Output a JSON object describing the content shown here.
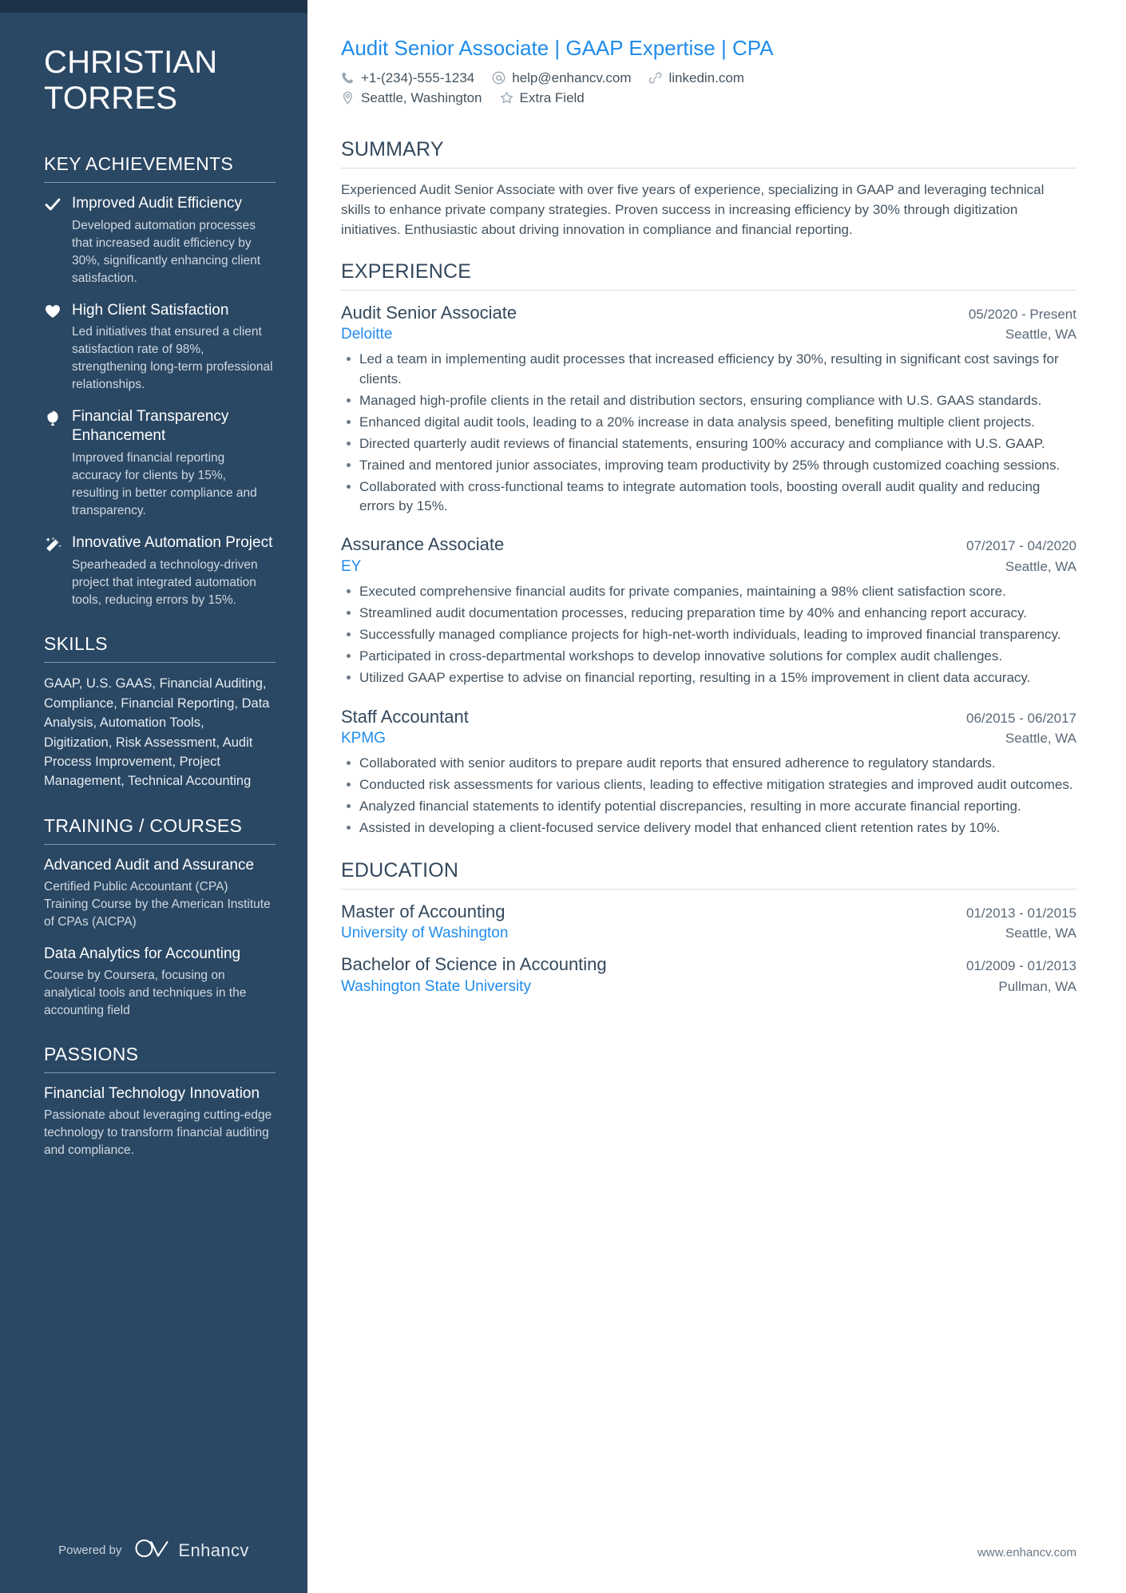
{
  "sidebar": {
    "name": "CHRISTIAN TORRES",
    "achievements": {
      "heading": "KEY ACHIEVEMENTS",
      "items": [
        {
          "icon": "check-icon",
          "title": "Improved Audit Efficiency",
          "desc": "Developed automation processes that increased audit efficiency by 30%, significantly enhancing client satisfaction."
        },
        {
          "icon": "heart-icon",
          "title": "High Client Satisfaction",
          "desc": "Led initiatives that ensured a client satisfaction rate of 98%, strengthening long-term professional relationships."
        },
        {
          "icon": "balloon-icon",
          "title": "Financial Transparency Enhancement",
          "desc": "Improved financial reporting accuracy for clients by 15%, resulting in better compliance and transparency."
        },
        {
          "icon": "magic-wand-icon",
          "title": "Innovative Automation Project",
          "desc": "Spearheaded a technology-driven project that integrated automation tools, reducing errors by 15%."
        }
      ]
    },
    "skills": {
      "heading": "SKILLS",
      "text": "GAAP, U.S. GAAS, Financial Auditing, Compliance, Financial Reporting, Data Analysis, Automation Tools, Digitization, Risk Assessment, Audit Process Improvement, Project Management, Technical Accounting"
    },
    "training": {
      "heading": "TRAINING / COURSES",
      "items": [
        {
          "title": "Advanced Audit and Assurance",
          "desc": "Certified Public Accountant (CPA) Training Course by the American Institute of CPAs (AICPA)"
        },
        {
          "title": "Data Analytics for Accounting",
          "desc": "Course by Coursera, focusing on analytical tools and techniques in the accounting field"
        }
      ]
    },
    "passions": {
      "heading": "PASSIONS",
      "items": [
        {
          "title": "Financial Technology Innovation",
          "desc": "Passionate about leveraging cutting-edge technology to transform financial auditing and compliance."
        }
      ]
    },
    "footer": {
      "powered_by": "Powered by",
      "brand": "Enhancv",
      "logo_icon": "enhancv-logo-icon"
    }
  },
  "main": {
    "headline": "Audit Senior Associate | GAAP Expertise | CPA",
    "contact": {
      "row1": [
        {
          "icon": "phone-icon",
          "value": "+1-(234)-555-1234"
        },
        {
          "icon": "email-icon",
          "value": "help@enhancv.com"
        },
        {
          "icon": "link-icon",
          "value": "linkedin.com"
        }
      ],
      "row2": [
        {
          "icon": "location-pin-icon",
          "value": "Seattle, Washington"
        },
        {
          "icon": "star-icon",
          "value": "Extra Field"
        }
      ]
    },
    "summary": {
      "heading": "SUMMARY",
      "text": "Experienced Audit Senior Associate with over five years of experience, specializing in GAAP and leveraging technical skills to enhance private company strategies. Proven success in increasing efficiency by 30% through digitization initiatives. Enthusiastic about driving innovation in compliance and financial reporting."
    },
    "experience": {
      "heading": "EXPERIENCE",
      "jobs": [
        {
          "title": "Audit Senior Associate",
          "dates": "05/2020 - Present",
          "company": "Deloitte",
          "location": "Seattle, WA",
          "bullets": [
            "Led a team in implementing audit processes that increased efficiency by 30%, resulting in significant cost savings for clients.",
            "Managed high-profile clients in the retail and distribution sectors, ensuring compliance with U.S. GAAS standards.",
            "Enhanced digital audit tools, leading to a 20% increase in data analysis speed, benefiting multiple client projects.",
            "Directed quarterly audit reviews of financial statements, ensuring 100% accuracy and compliance with U.S. GAAP.",
            "Trained and mentored junior associates, improving team productivity by 25% through customized coaching sessions.",
            "Collaborated with cross-functional teams to integrate automation tools, boosting overall audit quality and reducing errors by 15%."
          ]
        },
        {
          "title": "Assurance Associate",
          "dates": "07/2017 - 04/2020",
          "company": "EY",
          "location": "Seattle, WA",
          "bullets": [
            "Executed comprehensive financial audits for private companies, maintaining a 98% client satisfaction score.",
            "Streamlined audit documentation processes, reducing preparation time by 40% and enhancing report accuracy.",
            "Successfully managed compliance projects for high-net-worth individuals, leading to improved financial transparency.",
            "Participated in cross-departmental workshops to develop innovative solutions for complex audit challenges.",
            "Utilized GAAP expertise to advise on financial reporting, resulting in a 15% improvement in client data accuracy."
          ]
        },
        {
          "title": "Staff Accountant",
          "dates": "06/2015 - 06/2017",
          "company": "KPMG",
          "location": "Seattle, WA",
          "bullets": [
            "Collaborated with senior auditors to prepare audit reports that ensured adherence to regulatory standards.",
            "Conducted risk assessments for various clients, leading to effective mitigation strategies and improved audit outcomes.",
            "Analyzed financial statements to identify potential discrepancies, resulting in more accurate financial reporting.",
            "Assisted in developing a client-focused service delivery model that enhanced client retention rates by 10%."
          ]
        }
      ]
    },
    "education": {
      "heading": "EDUCATION",
      "entries": [
        {
          "degree": "Master of Accounting",
          "dates": "01/2013 - 01/2015",
          "school": "University of Washington",
          "location": "Seattle, WA"
        },
        {
          "degree": "Bachelor of Science in Accounting",
          "dates": "01/2009 - 01/2013",
          "school": "Washington State University",
          "location": "Pullman, WA"
        }
      ]
    },
    "footer_url": "www.enhancv.com"
  },
  "colors": {
    "sidebar_bg": "#2a4763",
    "sidebar_top": "#1d3249",
    "accent_blue": "#1f8ceb",
    "heading_slate": "#33485c",
    "body_text": "#44535f"
  }
}
